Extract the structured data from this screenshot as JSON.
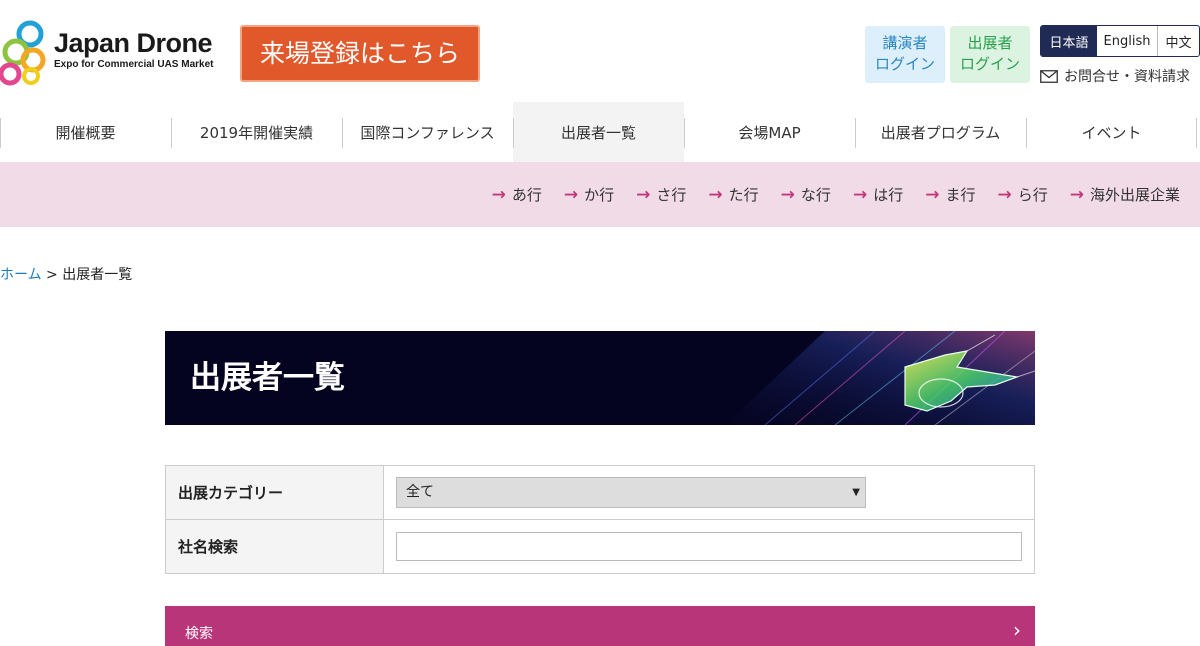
{
  "header": {
    "logo_title": "Japan Drone",
    "logo_subtitle": "Expo for Commercial UAS Market",
    "register_button": "来場登録はこちら",
    "lecturer_login": [
      "講演者",
      "ログイン"
    ],
    "exhibitor_login": [
      "出展者",
      "ログイン"
    ],
    "languages": [
      "日本語",
      "English",
      "中文"
    ],
    "contact_link": "お問合せ・資料請求"
  },
  "nav": {
    "items": [
      "開催概要",
      "2019年開催実績",
      "国際コンファレンス",
      "出展者一覧",
      "会場MAP",
      "出展者プログラム",
      "イベント"
    ],
    "active_index": 3
  },
  "subnav": {
    "items": [
      "あ行",
      "か行",
      "さ行",
      "た行",
      "な行",
      "は行",
      "ま行",
      "ら行",
      "海外出展企業"
    ]
  },
  "breadcrumb": {
    "home": "ホーム",
    "separator": " > ",
    "current": "出展者一覧"
  },
  "banner": {
    "title": "出展者一覧"
  },
  "search": {
    "category_label": "出展カテゴリー",
    "category_value": "全て",
    "company_label": "社名検索",
    "company_value": "",
    "button_label": "検索"
  },
  "colors": {
    "register": "#e1582b",
    "lecturer": "#2a86c4",
    "exhibitor": "#2aa04d",
    "subnav_bg": "#f1dbe7",
    "accent": "#b8357a",
    "banner_bg": "#050420"
  }
}
